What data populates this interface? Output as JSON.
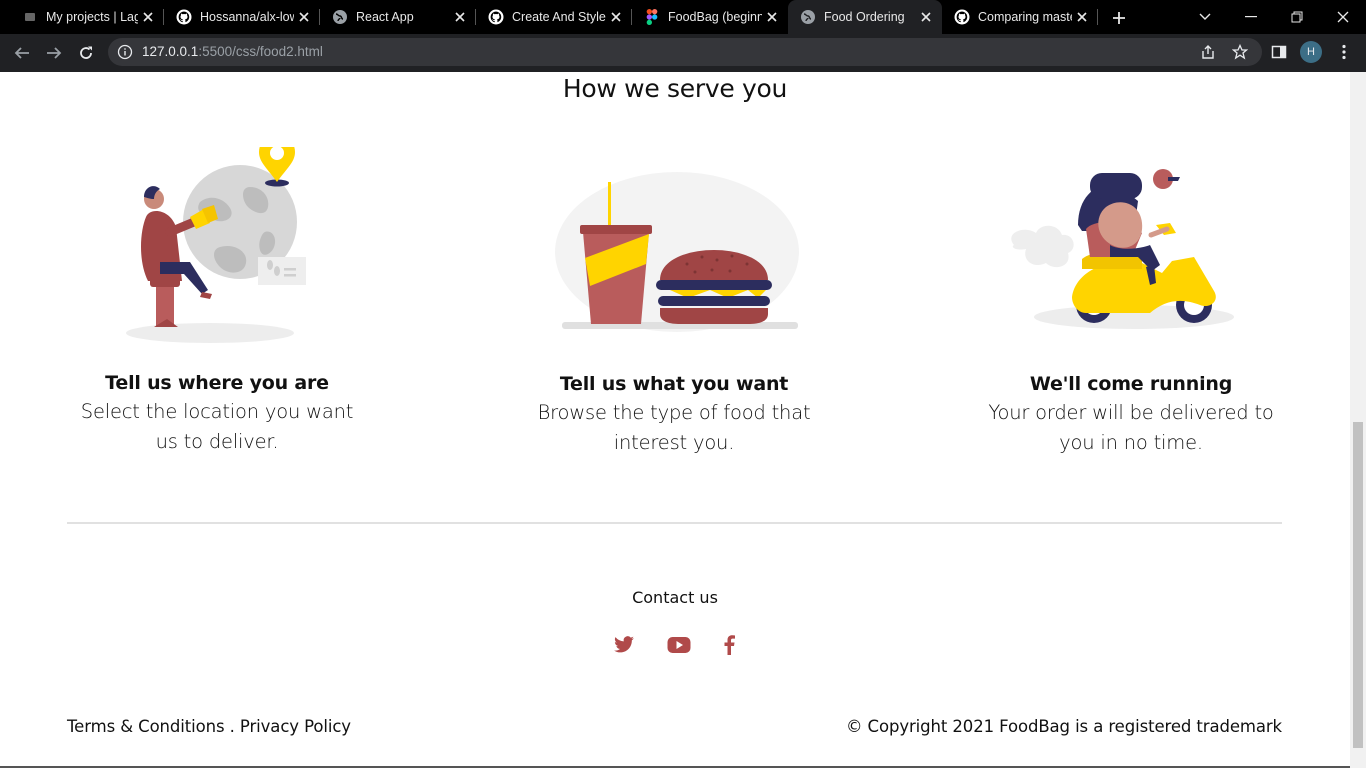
{
  "browser": {
    "tabs": [
      {
        "title": "My projects | Lag",
        "favicon": "generic-icon",
        "active": false
      },
      {
        "title": "Hossanna/alx-low",
        "favicon": "github-icon",
        "active": false
      },
      {
        "title": "React App",
        "favicon": "globe-icon",
        "active": false
      },
      {
        "title": "Create And Style",
        "favicon": "github-icon",
        "active": false
      },
      {
        "title": "FoodBag (beginn",
        "favicon": "figma-icon",
        "active": false
      },
      {
        "title": "Food Ordering",
        "favicon": "globe-icon",
        "active": true
      },
      {
        "title": "Comparing maste",
        "favicon": "github-icon",
        "active": false
      }
    ],
    "url_host": "127.0.0.1",
    "url_rest": ":5500/css/food2.html",
    "profile_initial": "H"
  },
  "page": {
    "heading": "How we serve you",
    "features": [
      {
        "title": "Tell us where you are",
        "desc_line1": "Select the location you want",
        "desc_line2": "us to deliver."
      },
      {
        "title": "Tell us what you want",
        "desc_line1": "Browse the type of food that",
        "desc_line2": "interest you."
      },
      {
        "title": "We'll come running",
        "desc_line1": "Your order will be delivered to",
        "desc_line2": "you in no time."
      }
    ],
    "contact_title": "Contact us",
    "social": [
      "twitter-icon",
      "youtube-icon",
      "facebook-icon"
    ],
    "footer_left": "Terms & Conditions . Privacy Policy",
    "footer_right": "© Copyright 2021 FoodBag is a registered trademark"
  },
  "colors": {
    "accent": "#b04a4a",
    "yellow": "#ffd400",
    "navy": "#2c2d5e"
  }
}
